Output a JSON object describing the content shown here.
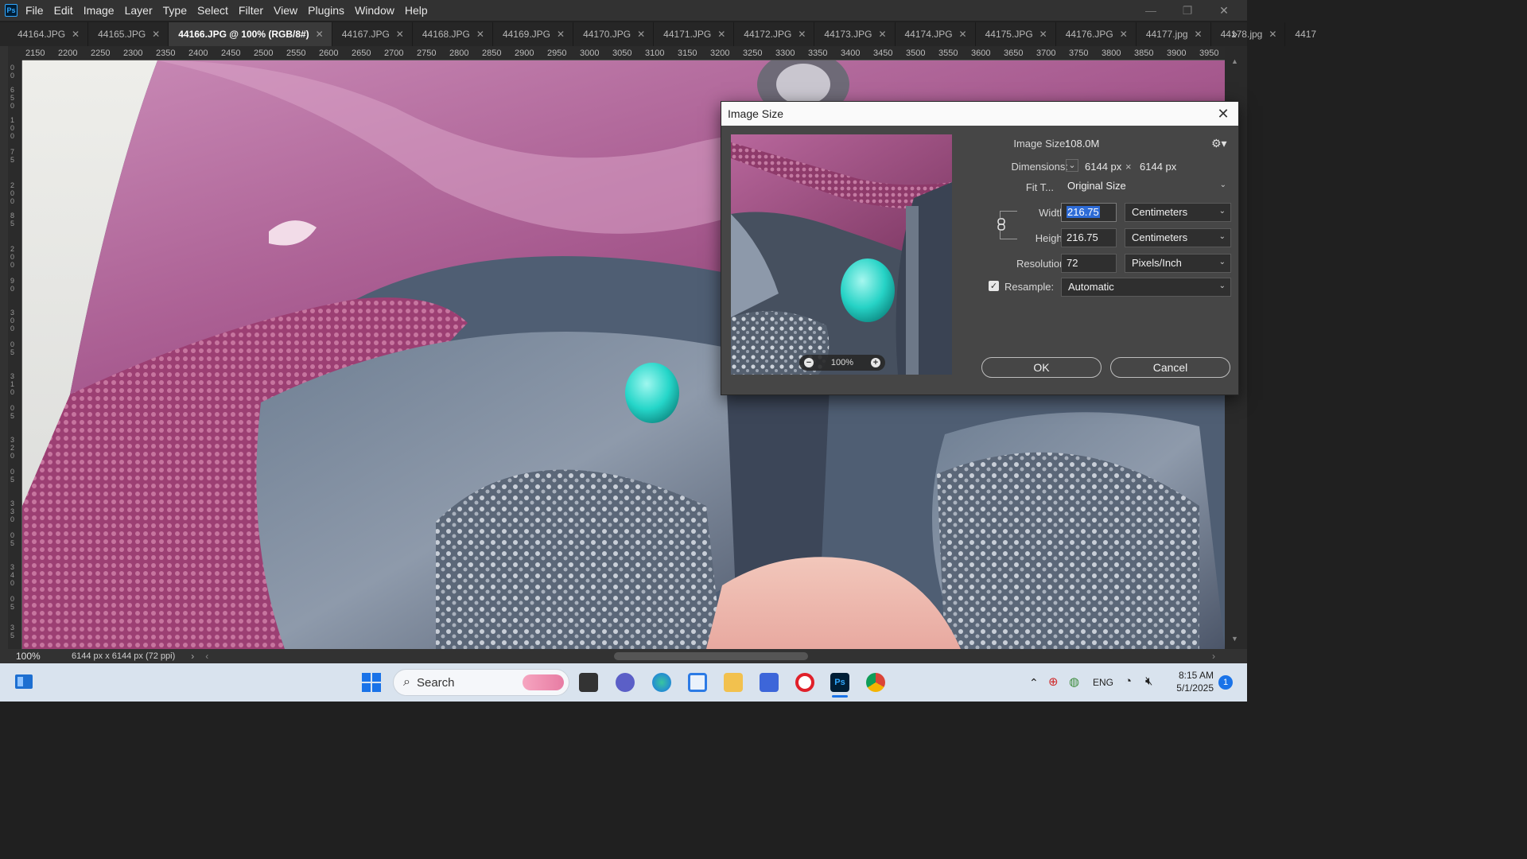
{
  "menubar": {
    "logo": "Ps",
    "items": [
      "File",
      "Edit",
      "Image",
      "Layer",
      "Type",
      "Select",
      "Filter",
      "View",
      "Plugins",
      "Window",
      "Help"
    ]
  },
  "tabs": [
    {
      "label": "44164.JPG",
      "active": false
    },
    {
      "label": "44165.JPG",
      "active": false
    },
    {
      "label": "44166.JPG @ 100% (RGB/8#)",
      "active": true
    },
    {
      "label": "44167.JPG",
      "active": false
    },
    {
      "label": "44168.JPG",
      "active": false
    },
    {
      "label": "44169.JPG",
      "active": false
    },
    {
      "label": "44170.JPG",
      "active": false
    },
    {
      "label": "44171.JPG",
      "active": false
    },
    {
      "label": "44172.JPG",
      "active": false
    },
    {
      "label": "44173.JPG",
      "active": false
    },
    {
      "label": "44174.JPG",
      "active": false
    },
    {
      "label": "44175.JPG",
      "active": false
    },
    {
      "label": "44176.JPG",
      "active": false
    },
    {
      "label": "44177.jpg",
      "active": false
    },
    {
      "label": "44178.jpg",
      "active": false
    },
    {
      "label": "4417",
      "active": false
    }
  ],
  "ruler": {
    "ticks": [
      "2150",
      "2200",
      "2250",
      "2300",
      "2350",
      "2400",
      "2450",
      "2500",
      "2550",
      "2600",
      "2650",
      "2700",
      "2750",
      "2800",
      "2850",
      "2900",
      "2950",
      "3000",
      "3050",
      "3100",
      "3150",
      "3200",
      "3250",
      "3300",
      "3350",
      "3400",
      "3450",
      "3500",
      "3550",
      "3600",
      "3650",
      "3700",
      "3750",
      "3800",
      "3850",
      "3900",
      "3950"
    ]
  },
  "status": {
    "zoom": "100%",
    "doc_info": "6144 px x 6144 px (72 ppi)"
  },
  "dialog": {
    "title": "Image Size",
    "preview_zoom": "100%",
    "image_size_label": "Image Size:",
    "image_size_value": "108.0M",
    "dimensions_label": "Dimensions:",
    "dim_width": "6144 px",
    "dim_times": "×",
    "dim_height": "6144 px",
    "fit_label": "Fit T...",
    "fit_value": "Original Size",
    "width_label": "Width:",
    "width_value": "216.75",
    "width_unit": "Centimeters",
    "height_label": "Height:",
    "height_value": "216.75",
    "height_unit": "Centimeters",
    "resolution_label": "Resolution:",
    "resolution_value": "72",
    "resolution_unit": "Pixels/Inch",
    "resample_label": "Resample:",
    "resample_checked": true,
    "resample_value": "Automatic",
    "ok_label": "OK",
    "cancel_label": "Cancel"
  },
  "taskbar": {
    "search_label": "Search",
    "lang": "ENG",
    "time": "8:15 AM",
    "date": "5/1/2025",
    "notification_count": "1"
  },
  "colors": {
    "accent": "#2d6bd6",
    "photoshop_blue": "#31a8ff",
    "dialog_bg": "#464646"
  }
}
